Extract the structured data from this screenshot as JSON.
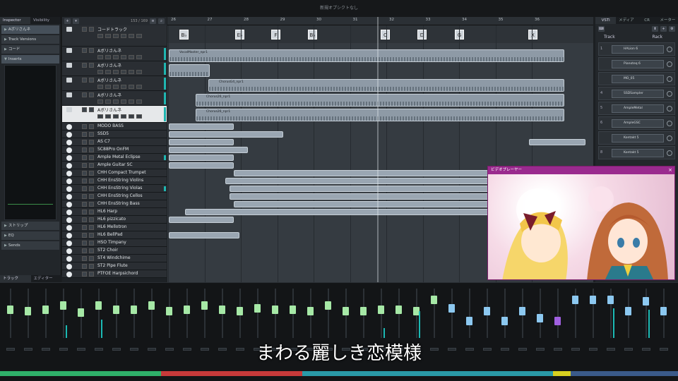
{
  "window": {
    "title": "新規オプシクトなし"
  },
  "inspector": {
    "tabs": [
      "Inspector",
      "Visibility"
    ],
    "track_name": "Aボリさんネ",
    "sections": [
      "Track Versions",
      "コード",
      "Inserts"
    ],
    "bottom_sections": [
      "ストリップ",
      "EQ",
      "Sends"
    ],
    "bottom_tabs": [
      "トラック",
      "エディター"
    ]
  },
  "tracklist": {
    "counter": "153 / 169",
    "tracks": [
      {
        "name": "コードトラック",
        "kind": "chord"
      },
      {
        "name": "Aボリさんネ",
        "kind": "audio"
      },
      {
        "name": "Aボリさんネ",
        "kind": "audio"
      },
      {
        "name": "Aボリさんネ",
        "kind": "audio"
      },
      {
        "name": "Aボリさんネ",
        "kind": "audio"
      },
      {
        "name": "Aボリさんネ",
        "kind": "audio-selected"
      },
      {
        "name": "MODO BASS",
        "kind": "inst"
      },
      {
        "name": "SSD5",
        "kind": "inst"
      },
      {
        "name": "AS C7",
        "kind": "inst"
      },
      {
        "name": "SC88Pro OnFM",
        "kind": "inst"
      },
      {
        "name": "Ample Metal Eclipse",
        "kind": "inst"
      },
      {
        "name": "Ample Guitar SC",
        "kind": "inst"
      },
      {
        "name": "CHH Compact Trumpet",
        "kind": "inst"
      },
      {
        "name": "CHH EnsString Violins",
        "kind": "inst"
      },
      {
        "name": "CHH EnsString Violas",
        "kind": "inst"
      },
      {
        "name": "CHH EnsString Cellos",
        "kind": "inst"
      },
      {
        "name": "CHH EnsString Bass",
        "kind": "inst"
      },
      {
        "name": "HL6 Harp",
        "kind": "inst"
      },
      {
        "name": "HL6 pizzicato",
        "kind": "inst"
      },
      {
        "name": "HL6 Mellotron",
        "kind": "inst"
      },
      {
        "name": "HL6 BellPad",
        "kind": "inst"
      },
      {
        "name": "HSO Timpany",
        "kind": "inst"
      },
      {
        "name": "ST2 Choir",
        "kind": "inst"
      },
      {
        "name": "ST4 Windchime",
        "kind": "inst"
      },
      {
        "name": "ST2 Pipe Flute",
        "kind": "inst"
      },
      {
        "name": "PTFOE Harpsichord",
        "kind": "inst"
      }
    ]
  },
  "ruler": {
    "bars": [
      "26",
      "27",
      "28",
      "29",
      "30",
      "31",
      "32",
      "33",
      "34",
      "35",
      "36"
    ]
  },
  "chords": [
    "B♭",
    "E♭",
    "F",
    "B♭",
    "C",
    "D",
    "G",
    "X"
  ],
  "parts": {
    "vocal_main": "VocalMaster_npr1",
    "chorus_a": "ChorusG4_npr1",
    "chorus_b": "Chorus26_npr1",
    "chorus_c": "Chorus26_npr1"
  },
  "vst": {
    "tabs": [
      "VSTi",
      "メディア",
      "CR",
      "メーター"
    ],
    "header_left": "Track",
    "header_right": "Rack",
    "slots": [
      {
        "num": "1",
        "name": "HALion 6"
      },
      {
        "name": "Pianoteq 6"
      },
      {
        "name": "MO_05"
      },
      {
        "num": "4",
        "name": "SSDSampler"
      },
      {
        "num": "5",
        "name": "AmpleMetal"
      },
      {
        "num": "6",
        "name": "AmpleGSC"
      },
      {
        "name": "Kontakt 5"
      },
      {
        "num": "8",
        "name": "Kontakt 5"
      }
    ]
  },
  "video": {
    "title": "ビデオプレーヤー"
  },
  "subtitle": "まわる麗しき恋模様",
  "colors": {
    "accent_teal": "#1fb5b0",
    "fader_green": "#a6e8a6",
    "fader_blue": "#8cc8f0",
    "video_title": "#9a2a8e"
  }
}
